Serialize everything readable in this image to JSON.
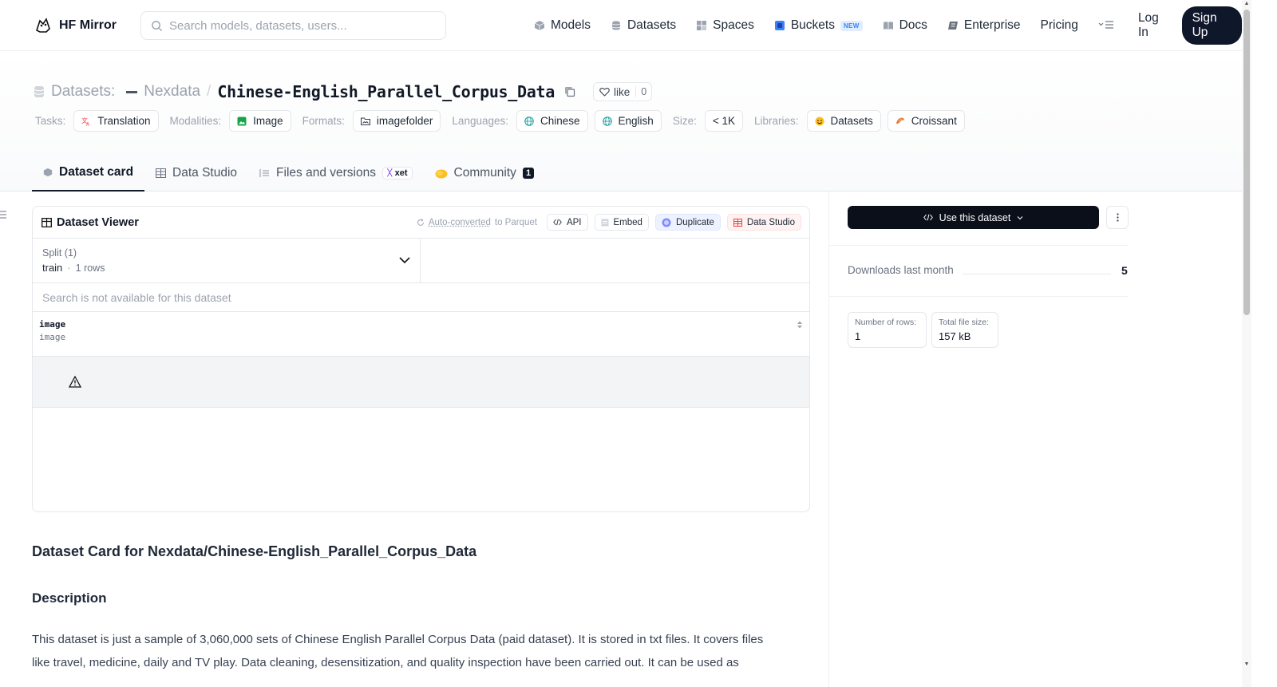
{
  "nav": {
    "brand": "HF Mirror",
    "search_placeholder": "Search models, datasets, users...",
    "links": {
      "models": "Models",
      "datasets": "Datasets",
      "spaces": "Spaces",
      "buckets": "Buckets",
      "buckets_badge": "NEW",
      "docs": "Docs",
      "enterprise": "Enterprise",
      "pricing": "Pricing"
    },
    "login": "Log In",
    "signup": "Sign Up"
  },
  "header": {
    "section_label": "Datasets:",
    "owner": "Nexdata",
    "separator": "/",
    "dataset_name": "Chinese-English_Parallel_Corpus_Data",
    "like_label": "like",
    "like_count": "0",
    "tags": {
      "tasks_key": "Tasks:",
      "task": "Translation",
      "modalities_key": "Modalities:",
      "modality": "Image",
      "formats_key": "Formats:",
      "format": "imagefolder",
      "languages_key": "Languages:",
      "language_1": "Chinese",
      "language_2": "English",
      "size_key": "Size:",
      "size": "< 1K",
      "libraries_key": "Libraries:",
      "library_1": "Datasets",
      "library_2": "Croissant"
    },
    "tabs": {
      "dataset_card": "Dataset card",
      "data_studio": "Data Studio",
      "files": "Files and versions",
      "files_badge": "xet",
      "community": "Community",
      "community_count": "1"
    }
  },
  "viewer": {
    "title": "Dataset Viewer",
    "auto_converted": "Auto-converted",
    "auto_converted_suffix": "to Parquet",
    "api": "API",
    "embed": "Embed",
    "duplicate": "Duplicate",
    "data_studio": "Data Studio",
    "split_label": "Split (1)",
    "split_value": "train",
    "split_dot": "·",
    "split_rows": "1 rows",
    "search_disabled": "Search is not available for this dataset",
    "column_name": "image",
    "column_type": "image"
  },
  "card": {
    "title": "Dataset Card for Nexdata/Chinese-English_Parallel_Corpus_Data",
    "description_heading": "Description",
    "description_text": "This dataset is just a sample of 3,060,000 sets of Chinese English Parallel Corpus Data (paid dataset). It is stored in txt files. It covers files like travel, medicine, daily and TV play. Data cleaning, desensitization, and quality inspection have been carried out. It can be used as"
  },
  "sidebar": {
    "use_dataset": "Use this dataset",
    "downloads_label": "Downloads last month",
    "downloads_value": "5",
    "rows_label": "Number of rows:",
    "rows_value": "1",
    "size_label": "Total file size:",
    "size_value": "157 kB"
  },
  "colors": {
    "primary_dark": "#0b0f19",
    "border": "#e5e7eb",
    "muted_text": "#9ca3af",
    "new_badge": "#3b82f6"
  }
}
